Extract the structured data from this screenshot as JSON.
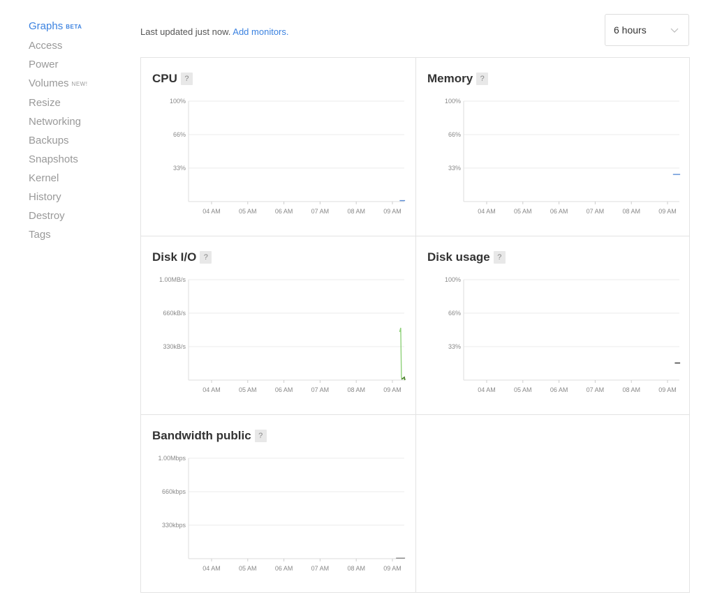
{
  "sidebar": {
    "items": [
      {
        "label": "Graphs",
        "badge": "BETA",
        "active": true
      },
      {
        "label": "Access"
      },
      {
        "label": "Power"
      },
      {
        "label": "Volumes",
        "badge": "NEW!"
      },
      {
        "label": "Resize"
      },
      {
        "label": "Networking"
      },
      {
        "label": "Backups"
      },
      {
        "label": "Snapshots"
      },
      {
        "label": "Kernel"
      },
      {
        "label": "History"
      },
      {
        "label": "Destroy"
      },
      {
        "label": "Tags"
      }
    ]
  },
  "header": {
    "status_text": "Last updated just now.",
    "add_monitors_link": "Add monitors.",
    "time_range": "6 hours"
  },
  "help_label": "?",
  "colors": {
    "accent": "#3b82e0",
    "cpu_line": "#5b8ed6",
    "memory_line": "#5b8ed6",
    "disk_io_read": "#8fd17a",
    "disk_io_write": "#4a7a2a",
    "disk_usage_line": "#333333",
    "bandwidth_line": "#888888"
  },
  "chart_data": [
    {
      "type": "line",
      "title": "CPU",
      "x_ticks": [
        "04 AM",
        "05 AM",
        "06 AM",
        "07 AM",
        "08 AM",
        "09 AM"
      ],
      "y_ticks": [
        "100%",
        "66%",
        "33%"
      ],
      "ylim": [
        0,
        100
      ],
      "series": [
        {
          "x": [
            9.2,
            9.35
          ],
          "values": [
            1,
            1
          ]
        }
      ]
    },
    {
      "type": "line",
      "title": "Memory",
      "x_ticks": [
        "04 AM",
        "05 AM",
        "06 AM",
        "07 AM",
        "08 AM",
        "09 AM"
      ],
      "y_ticks": [
        "100%",
        "66%",
        "33%"
      ],
      "ylim": [
        0,
        100
      ],
      "series": [
        {
          "x": [
            9.15,
            9.35
          ],
          "values": [
            27,
            27
          ]
        }
      ]
    },
    {
      "type": "line",
      "title": "Disk I/O",
      "x_ticks": [
        "04 AM",
        "05 AM",
        "06 AM",
        "07 AM",
        "08 AM",
        "09 AM"
      ],
      "y_ticks": [
        "1.00MB/s",
        "660kB/s",
        "330kB/s"
      ],
      "ylim": [
        0,
        1.0
      ],
      "series": [
        {
          "x": [
            9.2,
            9.23,
            9.25,
            9.27,
            9.3,
            9.35
          ],
          "values": [
            0.48,
            0.52,
            0.03,
            0.01,
            0.02,
            0.0
          ]
        },
        {
          "x": [
            9.25,
            9.3,
            9.33,
            9.35
          ],
          "values": [
            0.01,
            0.02,
            0.03,
            0.0
          ]
        }
      ]
    },
    {
      "type": "line",
      "title": "Disk usage",
      "x_ticks": [
        "04 AM",
        "05 AM",
        "06 AM",
        "07 AM",
        "08 AM",
        "09 AM"
      ],
      "y_ticks": [
        "100%",
        "66%",
        "33%"
      ],
      "ylim": [
        0,
        100
      ],
      "series": [
        {
          "x": [
            9.2,
            9.35
          ],
          "values": [
            17,
            17
          ]
        }
      ]
    },
    {
      "type": "line",
      "title": "Bandwidth public",
      "x_ticks": [
        "04 AM",
        "05 AM",
        "06 AM",
        "07 AM",
        "08 AM",
        "09 AM"
      ],
      "y_ticks": [
        "1.00Mbps",
        "660kbps",
        "330kbps"
      ],
      "ylim": [
        0,
        1.0
      ],
      "series": [
        {
          "x": [
            9.1,
            9.35
          ],
          "values": [
            0.005,
            0.005
          ]
        }
      ]
    }
  ]
}
